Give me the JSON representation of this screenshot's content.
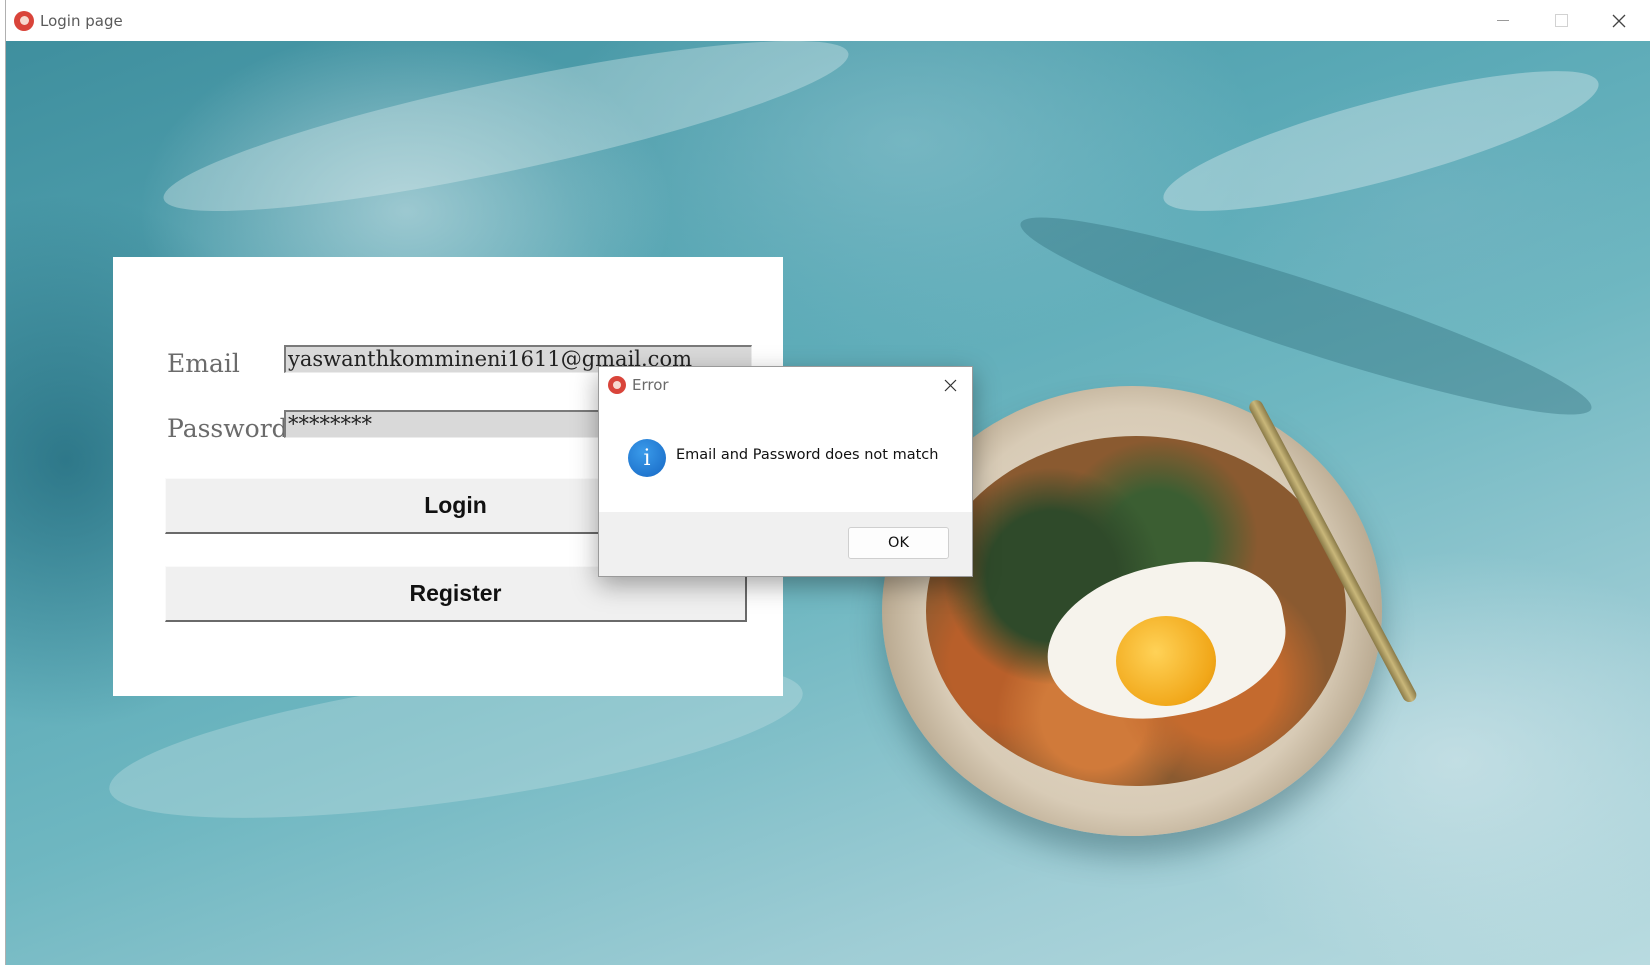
{
  "window": {
    "title": "Login page",
    "icon": "app-logo-icon",
    "controls": [
      "minimize-icon",
      "maximize-icon",
      "close-icon"
    ]
  },
  "login": {
    "email_label": "Email",
    "email_value": "yaswanthkommineni1611@gmail.com",
    "password_label": "Password",
    "password_value": "********",
    "login_button": "Login",
    "register_button": "Register"
  },
  "dialog": {
    "title": "Error",
    "message": "Email and Password does not match",
    "ok_button": "OK",
    "icon": "info-icon",
    "close_icon": "close-icon"
  },
  "colors": {
    "background_teal": "#5aa9b6",
    "info_blue": "#1667c4",
    "field_gray": "#d9d9d9"
  }
}
